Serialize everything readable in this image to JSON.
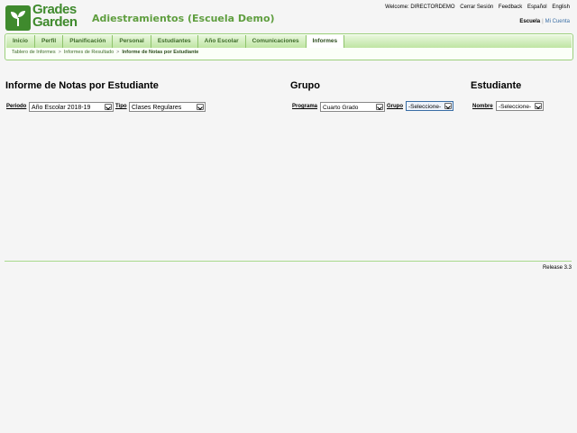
{
  "brand": {
    "line1": "Grades",
    "line2": "Garden"
  },
  "school": {
    "name": "Adiestramientos (Escuela Demo)"
  },
  "toplinks": {
    "welcome": "Welcome: DIRECTORDEMO",
    "logout": "Cerrar Sesión",
    "feedback": "Feedback",
    "spanish": "Español",
    "english": "English"
  },
  "sublinks": {
    "school": "Escuela",
    "separator": "|",
    "account": "Mi Cuenta"
  },
  "nav": {
    "tabs": [
      {
        "label": "Inicio"
      },
      {
        "label": "Perfil"
      },
      {
        "label": "Planificación"
      },
      {
        "label": "Personal"
      },
      {
        "label": "Estudiantes"
      },
      {
        "label": "Año Escolar"
      },
      {
        "label": "Comunicaciones"
      },
      {
        "label": "Informes"
      }
    ],
    "active": "Informes"
  },
  "breadcrumb": {
    "items": [
      "Tablero de Informes",
      "Informes de Resultado",
      "Informe de Notas por Estudiante"
    ],
    "separator": ">"
  },
  "report": {
    "title": "Informe de Notas por Estudiante",
    "period_label": "Periodo",
    "period_value": "Año Escolar 2018-19",
    "type_label": "Tipo",
    "type_value": "Clases Regulares"
  },
  "group": {
    "title": "Grupo",
    "program_label": "Programa",
    "program_value": "Cuarto Grado",
    "group_label": "Grupo",
    "group_value": "-Seleccione-"
  },
  "student": {
    "title": "Estudiante",
    "name_label": "Nombre",
    "name_value": "-Seleccione-"
  },
  "footer": {
    "release": "Release 3.3"
  },
  "colors": {
    "brand_green": "#3f8a2d",
    "nav_green": "#bfe5a3",
    "school_name": "#5f9e3f"
  }
}
